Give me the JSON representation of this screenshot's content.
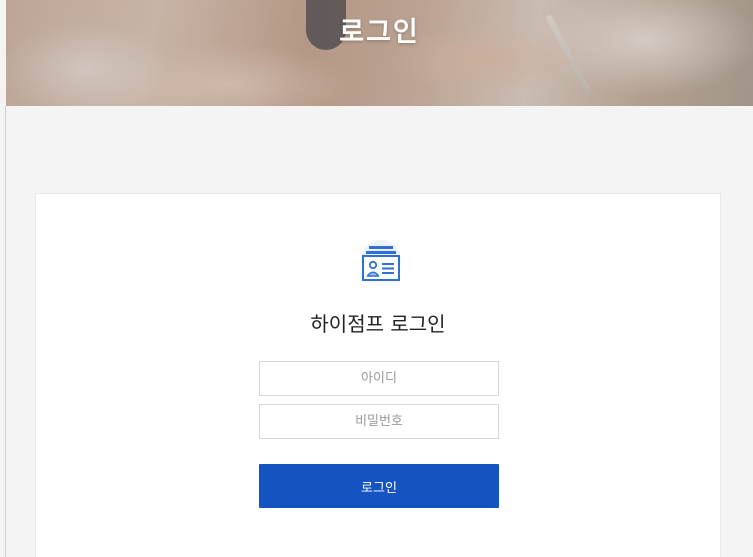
{
  "banner": {
    "title": "로그인"
  },
  "login_card": {
    "icon": "id-card-icon",
    "title": "하이점프 로그인",
    "id_field": {
      "placeholder": "아이디",
      "value": ""
    },
    "password_field": {
      "placeholder": "비밀번호",
      "value": ""
    },
    "submit_label": "로그인"
  },
  "colors": {
    "primary_button": "#1554c0",
    "icon_blue": "#2f6fd6",
    "page_background": "#f4f4f4",
    "card_background": "#ffffff"
  }
}
